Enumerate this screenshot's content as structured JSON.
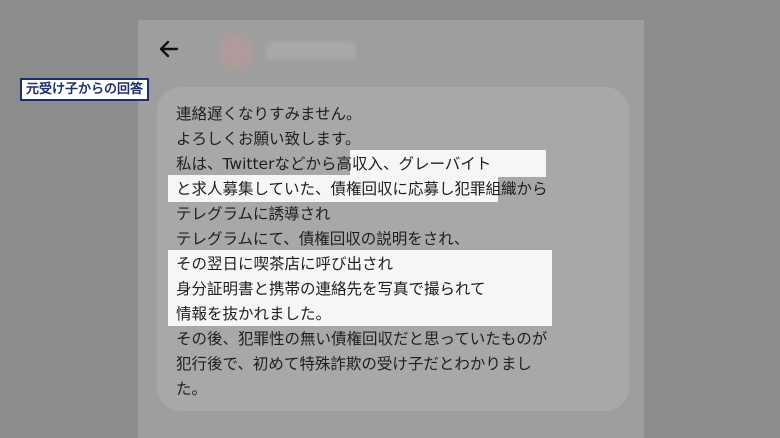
{
  "caption": "元受け子からの回答",
  "header": {
    "back_icon": "arrow-left-icon"
  },
  "message": {
    "lines": [
      "連絡遅くなりすみません。",
      "よろしくお願い致します。",
      "私は、Twitterなどから高収入、グレーバイト",
      "と求人募集していた、債権回収に応募し犯罪組織から",
      "テレグラムに誘導され",
      "テレグラムにて、債権回収の説明をされ、",
      "その翌日に喫茶店に呼び出され",
      "身分証明書と携帯の連絡先を写真で撮られて",
      "情報を抜かれました。",
      "その後、犯罪性の無い債権回収だと思っていたものが",
      "犯行後で、初めて特殊詐欺の受け子だとわかりまし",
      "た。"
    ]
  }
}
